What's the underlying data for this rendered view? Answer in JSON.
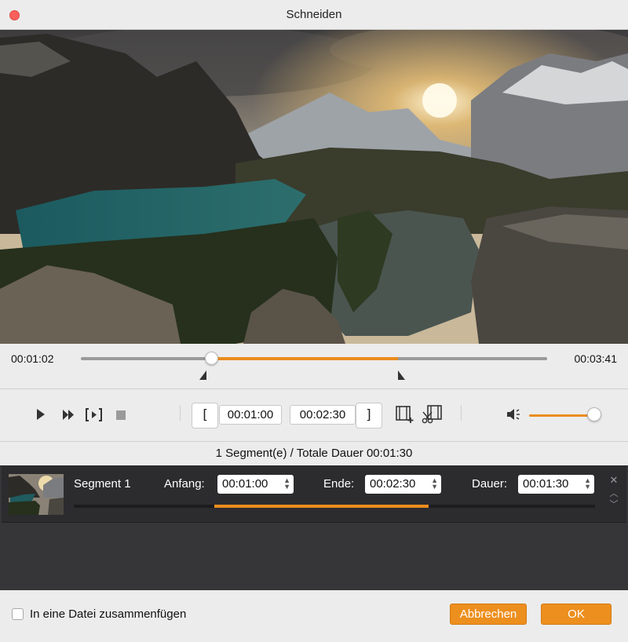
{
  "window": {
    "title": "Schneiden"
  },
  "timeline": {
    "current_time": "00:01:02",
    "total_time": "00:03:41",
    "playhead_fraction": 0.28,
    "selection_start_fraction": 0.27,
    "selection_end_fraction": 0.68
  },
  "controls": {
    "start_time": "00:01:00",
    "end_time": "00:02:30",
    "start_bracket": "[",
    "end_bracket": "]",
    "volume_fraction": 0.9
  },
  "summary": "1 Segment(e) / Totale Dauer 00:01:30",
  "segment": {
    "name": "Segment 1",
    "start_label": "Anfang:",
    "start_value": "00:01:00",
    "end_label": "Ende:",
    "end_value": "00:02:30",
    "duration_label": "Dauer:",
    "duration_value": "00:01:30",
    "selection_start_fraction": 0.27,
    "selection_end_fraction": 0.68
  },
  "footer": {
    "merge_label": "In eine Datei zusammenfügen",
    "merge_checked": false,
    "cancel_label": "Abbrechen",
    "ok_label": "OK"
  },
  "colors": {
    "accent": "#ea8c1e",
    "close": "#fc605c",
    "panel": "#363639"
  },
  "icons": [
    "close-icon",
    "play-icon",
    "fast-forward-icon",
    "preview-clip-icon",
    "stop-icon",
    "add-segment-icon",
    "split-scissors-icon",
    "volume-icon",
    "spin-arrows-icon",
    "remove-segment-icon",
    "move-up-icon",
    "move-down-icon"
  ]
}
